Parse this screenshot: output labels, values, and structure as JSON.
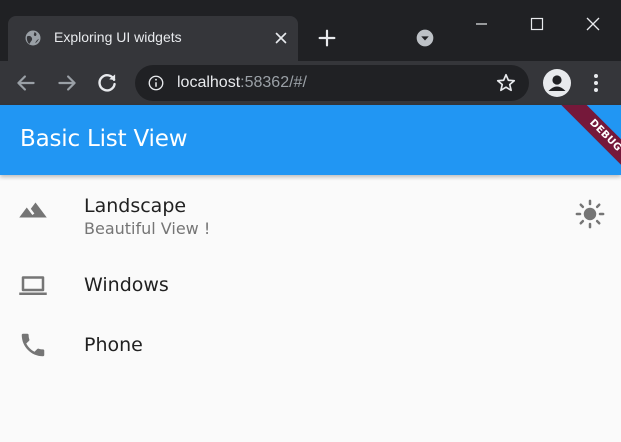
{
  "browser": {
    "tab": {
      "title": "Exploring UI widgets",
      "favicon": "globe-icon"
    },
    "new_tab_icon": "plus-icon",
    "address": {
      "host": "localhost",
      "rest": ":58362/#/"
    },
    "colors": {
      "frame": "#202124",
      "toolbar": "#35363a",
      "text": "#e8eaed",
      "muted": "#9aa0a6"
    }
  },
  "app": {
    "title": "Basic List View",
    "debug_banner": "DEBUG",
    "colors": {
      "appbar": "#2196f3",
      "icon": "#757575",
      "background": "#fafafa"
    },
    "items": [
      {
        "title": "Landscape",
        "subtitle": "Beautiful View !",
        "icon": "landscape-icon",
        "trailing_icon": "sun-icon"
      },
      {
        "title": "Windows",
        "icon": "laptop-icon"
      },
      {
        "title": "Phone",
        "icon": "phone-icon"
      }
    ]
  }
}
